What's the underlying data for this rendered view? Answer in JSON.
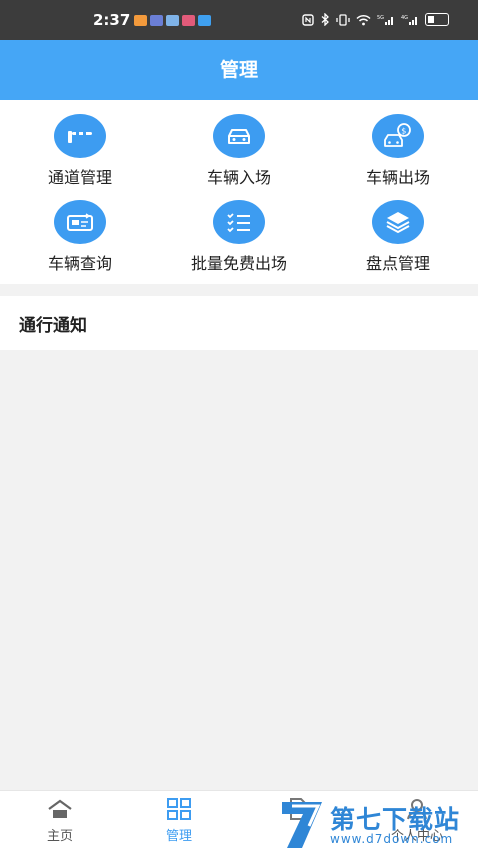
{
  "status_bar": {
    "time": "2:37",
    "icons": [
      "app-notification-icons",
      "nfc-icon",
      "bluetooth-icon",
      "vibrate-icon",
      "wifi-icon",
      "signal-5g-icon",
      "signal-4g-icon",
      "battery-icon"
    ]
  },
  "header": {
    "title": "管理"
  },
  "grid": {
    "items": [
      {
        "label": "通道管理",
        "icon": "gate-barrier-icon"
      },
      {
        "label": "车辆入场",
        "icon": "car-icon"
      },
      {
        "label": "车辆出场",
        "icon": "car-payment-icon"
      },
      {
        "label": "车辆查询",
        "icon": "vehicle-card-icon"
      },
      {
        "label": "批量免费出场",
        "icon": "checklist-icon"
      },
      {
        "label": "盘点管理",
        "icon": "layers-icon"
      }
    ]
  },
  "notice": {
    "title": "通行通知"
  },
  "tabbar": {
    "tabs": [
      {
        "label": "主页",
        "icon": "home-icon",
        "active": false
      },
      {
        "label": "管理",
        "icon": "grid-icon",
        "active": true
      },
      {
        "label": "",
        "icon": "document-icon",
        "active": false
      },
      {
        "label": "个人中心",
        "icon": "user-icon",
        "active": false
      }
    ]
  },
  "watermark": {
    "name": "第七下载站",
    "url": "www.d7down.com"
  },
  "colors": {
    "primary": "#45a6f6",
    "icon_bg": "#3d9cf1",
    "status_bar": "#3c3c3c",
    "page_bg": "#f2f2f2"
  }
}
